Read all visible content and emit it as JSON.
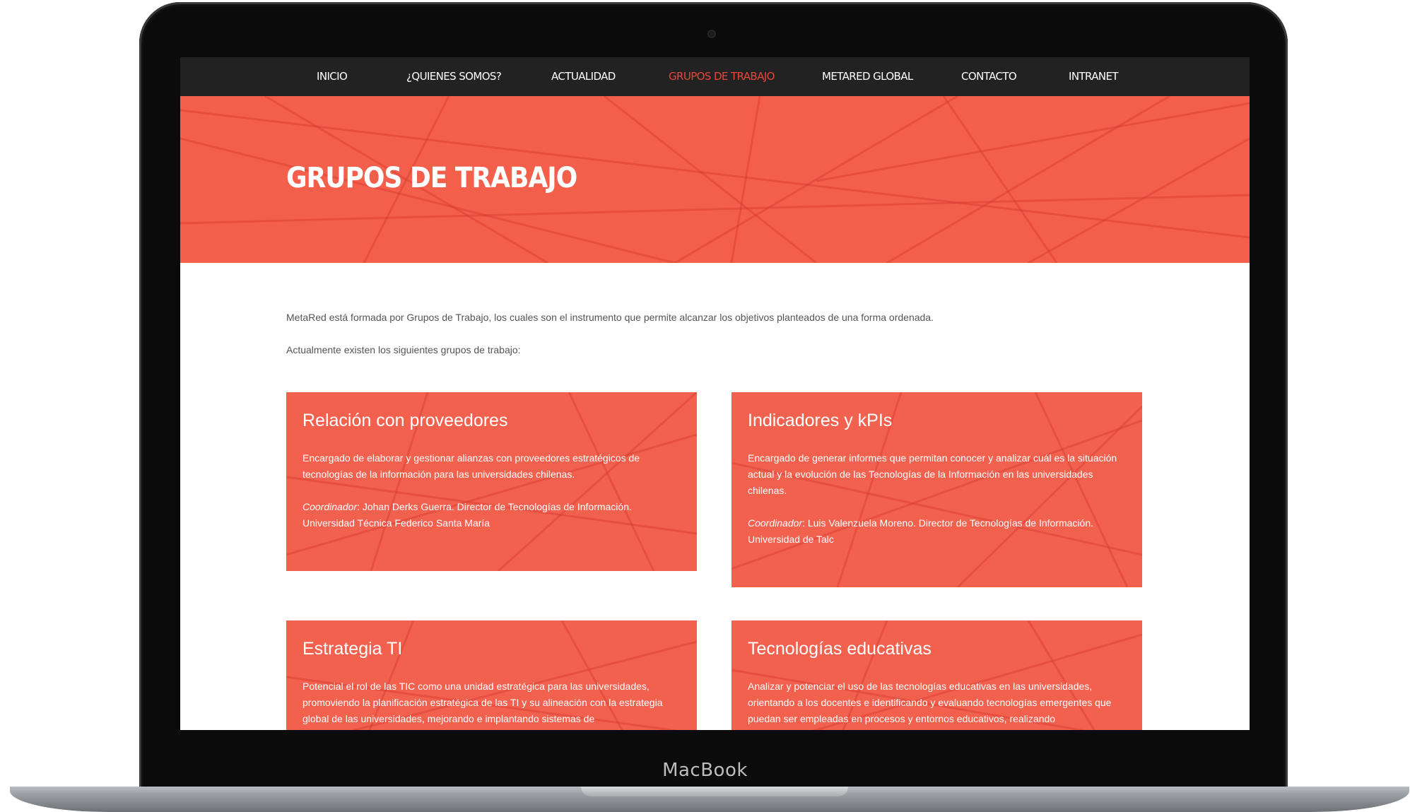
{
  "device": {
    "label": "MacBook"
  },
  "nav": {
    "items": [
      {
        "label": "INICIO"
      },
      {
        "label": "¿QUIENES SOMOS?"
      },
      {
        "label": "ACTUALIDAD"
      },
      {
        "label": "GRUPOS DE TRABAJO",
        "active": true
      },
      {
        "label": "METARED GLOBAL"
      },
      {
        "label": "CONTACTO"
      },
      {
        "label": "INTRANET"
      }
    ],
    "active_color": "#e8453c"
  },
  "hero": {
    "title": "GRUPOS DE TRABAJO",
    "color": "#f45f4c"
  },
  "intro": {
    "p1": "MetaRed está formada por Grupos de Trabajo, los cuales son el instrumento que permite alcanzar los objetivos planteados de una forma ordenada.",
    "p2": "Actualmente existen los siguientes grupos de trabajo:"
  },
  "groups": [
    {
      "title": "Relación con proveedores",
      "description": "Encargado de elaborar y gestionar alianzas con proveedores estratégicos de tecnologías de la información para las universidades chilenas.",
      "coordinator_label": "Coordinador",
      "coordinator": ": Johan Derks Guerra. Director de Tecnologías de Información. Universidad Técnica Federico Santa María"
    },
    {
      "title": "Indicadores y kPIs",
      "description": "Encargado de generar informes que permitan conocer y analizar cuál es la situación actual y la evolución de las Tecnologías de la Información en las universidades chilenas.",
      "coordinator_label": "Coordinador",
      "coordinator": ": Luis Valenzuela Moreno. Director de Tecnologías de Información. Universidad de Talc"
    },
    {
      "title": "Estrategia TI",
      "description": "Potencial el rol de las TIC como una unidad estratégica para las universidades, promoviendo la planificación estratégica de las TI y su alineación con la estrategia global de las universidades, mejorando e implantando sistemas de"
    },
    {
      "title": "Tecnologías educativas",
      "description": "Analizar y potenciar el uso de las tecnologías educativas en las universidades, orientando a los docentes e identificando y evaluando tecnologías emergentes que puedan ser empleadas en procesos y entornos educativos, realizando"
    }
  ],
  "colors": {
    "card": "#f2604e",
    "nav_bg": "#222222"
  }
}
